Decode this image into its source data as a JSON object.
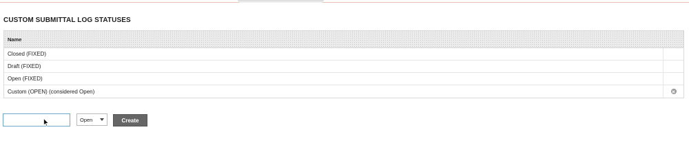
{
  "section": {
    "title": "CUSTOM SUBMITTAL LOG STATUSES"
  },
  "table": {
    "header": {
      "name": "Name"
    },
    "rows": [
      {
        "name": "Closed (FIXED)",
        "deletable": false
      },
      {
        "name": "Draft (FIXED)",
        "deletable": false
      },
      {
        "name": "Open (FIXED)",
        "deletable": false
      },
      {
        "name": "Custom (OPEN) (considered Open)",
        "deletable": true
      }
    ]
  },
  "form": {
    "name_input": {
      "value": "",
      "placeholder": ""
    },
    "status_select": {
      "selected": "Open"
    },
    "create_label": "Create"
  },
  "icons": {
    "delete": "delete-icon",
    "dropdown": "chevron-down-icon",
    "cursor": "mouse-cursor-icon"
  },
  "colors": {
    "button_bg": "#666666",
    "input_focus_border": "#6ea8c8",
    "top_rule": "#e7c4b5"
  }
}
